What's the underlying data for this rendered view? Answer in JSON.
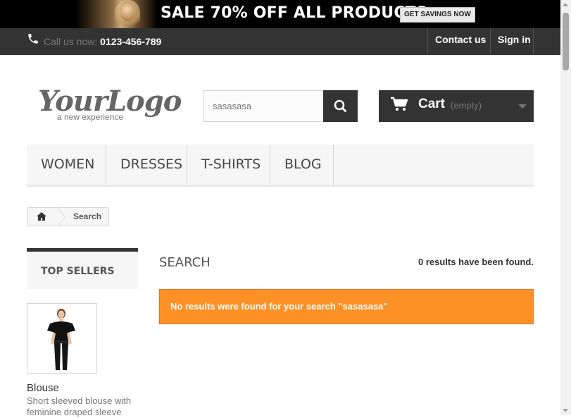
{
  "banner": {
    "text": "SALE 70% OFF ALL PRODUCTS",
    "cta": "GET SAVINGS NOW"
  },
  "header": {
    "call_label": "Call us now:",
    "phone": "0123-456-789",
    "contact": "Contact us",
    "signin": "Sign in"
  },
  "logo": {
    "main": "YourLogo",
    "tagline": "a new experience"
  },
  "search": {
    "value": "sasasasa"
  },
  "cart": {
    "label": "Cart",
    "status": "(empty)"
  },
  "menu": {
    "items": [
      "WOMEN",
      "DRESSES",
      "T-SHIRTS",
      "BLOG"
    ]
  },
  "breadcrumb": {
    "current": "Search"
  },
  "sidebar": {
    "title": "TOP SELLERS",
    "product": {
      "name": "Blouse",
      "description": "Short sleeved blouse with feminine draped sleeve"
    }
  },
  "main": {
    "heading": "SEARCH",
    "results": "0 results have been found.",
    "alert": "No results were found for your search \"sasasasa\""
  },
  "colors": {
    "dark": "#333333",
    "alert": "#fe9126"
  }
}
